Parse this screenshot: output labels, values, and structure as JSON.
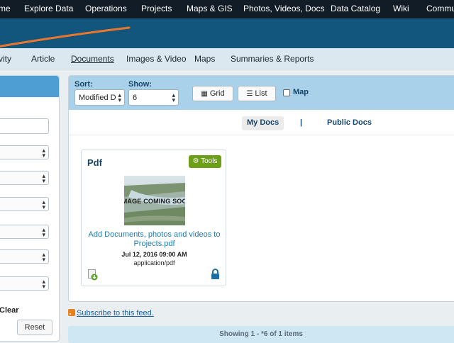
{
  "topnav": {
    "items": [
      "me",
      "Explore Data",
      "Operations",
      "Projects",
      "Maps & GIS",
      "Photos, Videos, Docs",
      "Data Catalog",
      "Wiki",
      "Commu"
    ]
  },
  "subnav": {
    "items": [
      "vity",
      "Article",
      "Documents",
      "Images & Video",
      "Maps",
      "Summaries & Reports"
    ],
    "active": "Documents"
  },
  "sidebar": {
    "clear_label": "Clear",
    "reset_label": "Reset"
  },
  "toolbar": {
    "sort_label": "Sort:",
    "sort_value": "Modified D",
    "show_label": "Show:",
    "show_value": "6",
    "grid_label": "Grid",
    "list_label": "List",
    "map_label": "Map"
  },
  "doc_tabs": {
    "my_docs": "My Docs",
    "separator": "|",
    "public_docs": "Public Docs"
  },
  "card": {
    "title": "Pdf",
    "tools_label": "Tools",
    "thumbnail_text": "IMAGE COMING SOON",
    "link_text": "Add Documents, photos and videos to Projects.pdf",
    "date": "Jul 12, 2016 09:00 AM",
    "mime_type": "application/pdf"
  },
  "feed": {
    "subscribe_label": "Subscribe to this feed."
  },
  "pager": {
    "status": "Showing 1 - *6 of 1 items"
  },
  "colors": {
    "top_nav_bg": "#111c26",
    "banner_bg": "#12567e",
    "banner_stroke": "#e8762c",
    "toolbar_bg": "#a9d1ea",
    "tools_button": "#6c9e17",
    "link": "#1e7bb0"
  }
}
